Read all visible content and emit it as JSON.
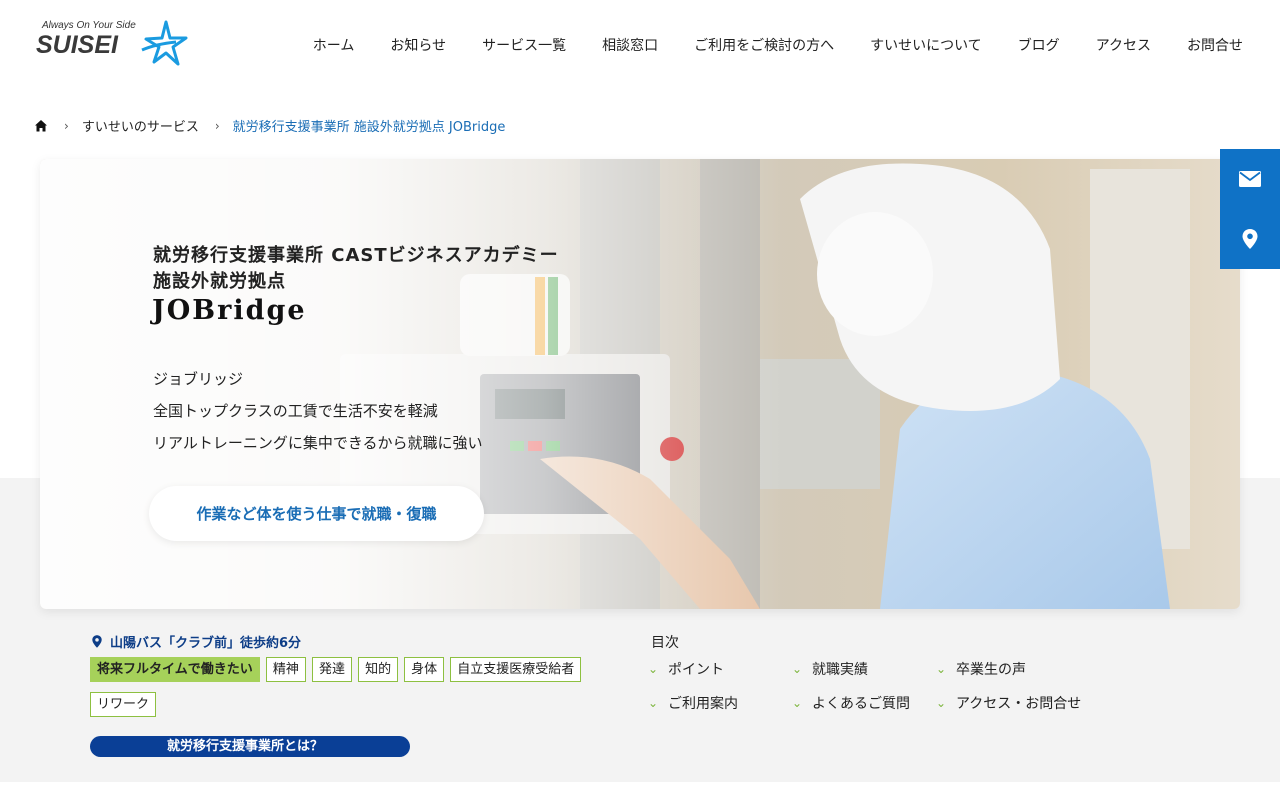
{
  "header": {
    "logo_tagline": "Always On Your Side",
    "logo_name": "SUISEI",
    "nav": [
      {
        "label": "ホーム"
      },
      {
        "label": "お知らせ"
      },
      {
        "label": "サービス一覧"
      },
      {
        "label": "相談窓口"
      },
      {
        "label": "ご利用をご検討の方へ"
      },
      {
        "label": "すいせいについて"
      },
      {
        "label": "ブログ"
      },
      {
        "label": "アクセス"
      },
      {
        "label": "お問合せ"
      }
    ]
  },
  "breadcrumb": {
    "items": [
      "すいせいのサービス"
    ],
    "current": "就労移行支援事業所 施設外就労拠点 JOBridge"
  },
  "hero": {
    "title_line1": "就労移行支援事業所 CASTビジネスアカデミー",
    "title_line2": "施設外就労拠点",
    "brand": "JOBridge",
    "sub_lines": [
      "ジョブリッジ",
      "全国トップクラスの工賃で生活不安を軽減",
      "リアルトレーニングに集中できるから就職に強い"
    ],
    "button_label": "作業など体を使う仕事で就職・復職"
  },
  "side_buttons": [
    {
      "icon": "mail-icon"
    },
    {
      "icon": "map-pin-icon"
    }
  ],
  "info": {
    "access": "山陽バス「クラブ前」徒歩約6分",
    "tags": [
      "将来フルタイムで働きたい",
      "精神",
      "発達",
      "知的",
      "身体",
      "自立支援医療受給者",
      "リワーク"
    ],
    "about_label": "就労移行支援事業所とは？"
  },
  "toc": {
    "heading": "目次",
    "items": [
      "ポイント",
      "就職実績",
      "卒業生の声",
      "ご利用案内",
      "よくあるご質問",
      "アクセス・お問合せ"
    ]
  },
  "colors": {
    "accent_blue": "#0f72c6",
    "navy": "#0a3f96",
    "tag_green": "#a6d15a",
    "chevron_green": "#7cb53c"
  }
}
